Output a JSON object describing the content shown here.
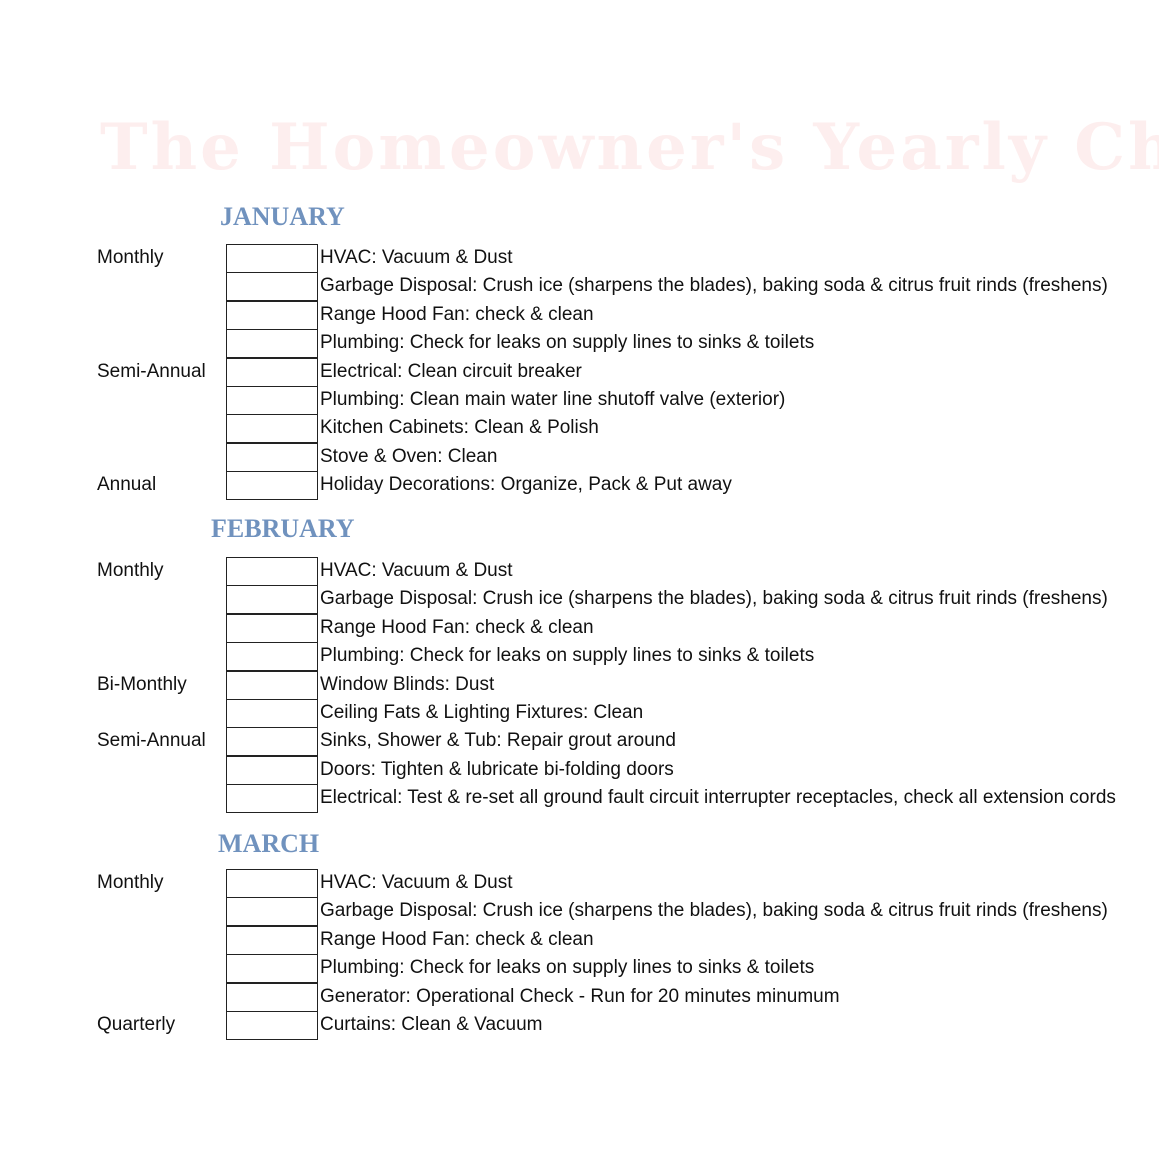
{
  "title": "The Homeowner's Yearly Checklist",
  "colors": {
    "month_heading": "#7092be",
    "title": "#fdeeee"
  },
  "months": [
    {
      "name": "JANUARY",
      "tasks": [
        {
          "frequency": "Monthly",
          "task": "HVAC: Vacuum & Dust",
          "checked": false
        },
        {
          "frequency": "",
          "task": "Garbage Disposal: Crush ice (sharpens the blades), baking soda & citrus fruit rinds (freshens)",
          "checked": false
        },
        {
          "frequency": "",
          "task": "Range Hood Fan: check & clean",
          "checked": false
        },
        {
          "frequency": "",
          "task": "Plumbing: Check for leaks on supply lines to sinks & toilets",
          "checked": false
        },
        {
          "frequency": "Semi-Annual",
          "task": "Electrical: Clean circuit breaker",
          "checked": false
        },
        {
          "frequency": "",
          "task": "Plumbing: Clean main water line shutoff  valve (exterior)",
          "checked": false
        },
        {
          "frequency": "",
          "task": "Kitchen Cabinets: Clean & Polish",
          "checked": false
        },
        {
          "frequency": "",
          "task": "Stove & Oven: Clean",
          "checked": false
        },
        {
          "frequency": "Annual",
          "task": "Holiday Decorations: Organize, Pack & Put away",
          "checked": false
        }
      ]
    },
    {
      "name": "FEBRUARY",
      "tasks": [
        {
          "frequency": "Monthly",
          "task": "HVAC: Vacuum & Dust",
          "checked": false
        },
        {
          "frequency": "",
          "task": "Garbage Disposal: Crush ice (sharpens the blades), baking soda & citrus fruit rinds (freshens)",
          "checked": false
        },
        {
          "frequency": "",
          "task": "Range Hood Fan: check & clean",
          "checked": false
        },
        {
          "frequency": "",
          "task": "Plumbing: Check for leaks on supply lines to sinks & toilets",
          "checked": false
        },
        {
          "frequency": "Bi-Monthly",
          "task": "Window Blinds: Dust",
          "checked": false
        },
        {
          "frequency": "",
          "task": "Ceiling Fats & Lighting Fixtures: Clean",
          "checked": false
        },
        {
          "frequency": "Semi-Annual",
          "task": "Sinks, Shower & Tub: Repair grout around",
          "checked": false
        },
        {
          "frequency": "",
          "task": "Doors: Tighten & lubricate bi-folding doors",
          "checked": false
        },
        {
          "frequency": "",
          "task": "Electrical: Test & re-set all ground fault circuit interrupter receptacles, check all extension cords",
          "checked": false
        }
      ]
    },
    {
      "name": "MARCH",
      "tasks": [
        {
          "frequency": "Monthly",
          "task": "HVAC: Vacuum & Dust",
          "checked": false
        },
        {
          "frequency": "",
          "task": "Garbage Disposal: Crush ice (sharpens the blades), baking soda & citrus fruit rinds (freshens)",
          "checked": false
        },
        {
          "frequency": "",
          "task": "Range Hood Fan: check & clean",
          "checked": false
        },
        {
          "frequency": "",
          "task": "Plumbing: Check for leaks on supply lines to sinks & toilets",
          "checked": false
        },
        {
          "frequency": "",
          "task": "Generator: Operational Check - Run for 20 minutes minumum",
          "checked": false
        },
        {
          "frequency": "Quarterly",
          "task": "Curtains: Clean & Vacuum",
          "checked": false
        }
      ]
    }
  ]
}
